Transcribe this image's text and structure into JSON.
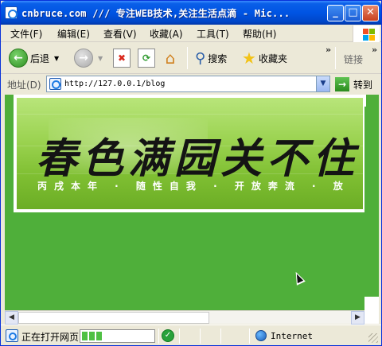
{
  "window": {
    "title": "cnbruce.com /// 专注WEB技术,关注生活点滴 - Mic...",
    "min_glyph": "_",
    "max_glyph": "□",
    "close_glyph": "✕"
  },
  "menu": {
    "items": [
      "文件(F)",
      "编辑(E)",
      "查看(V)",
      "收藏(A)",
      "工具(T)",
      "帮助(H)"
    ]
  },
  "toolbar": {
    "back_label": "后退",
    "search_label": "搜索",
    "favorites_label": "收藏夹",
    "links_label": "链接",
    "more": "»"
  },
  "address": {
    "label": "地址(D)",
    "url": "http://127.0.0.1/blog",
    "go_label": "转到"
  },
  "banner": {
    "title": "春色满园关不住",
    "subtitle": "丙戌本年 · 随性自我 · 开放奔流 · 放"
  },
  "status": {
    "text": "正在打开网页",
    "progress": 0.3,
    "zone": "Internet"
  },
  "colors": {
    "content_bg": "#4faf3a",
    "titlebar": "#0054e3",
    "banner_green": "#9ad24f"
  }
}
